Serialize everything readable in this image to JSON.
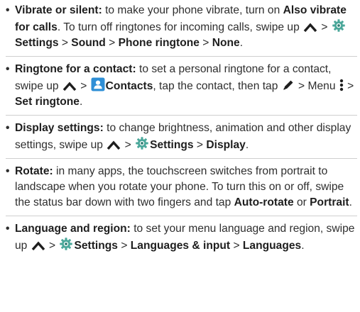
{
  "items": [
    {
      "title": "Vibrate or silent:",
      "t1": " to make your phone vibrate, turn on ",
      "b1": "Also vibrate for calls",
      "t2": ". To turn off ringtones for incoming calls, swipe up ",
      "t3": " > ",
      "b2": "Settings",
      "t4": " > ",
      "b3": "Sound",
      "t5": " > ",
      "b4": "Phone ringtone",
      "t6": " > ",
      "b5": "None",
      "t7": "."
    },
    {
      "title": "Ringtone for a contact:",
      "t1": " to set a personal ringtone for a contact, swipe up ",
      "t2": " > ",
      "b1": "Contacts",
      "t3": ", tap the contact, then tap ",
      "t4": " > Menu ",
      "t5": " > ",
      "b2": "Set ringtone",
      "t6": "."
    },
    {
      "title": "Display settings:",
      "t1": " to change brightness, animation and other display settings, swipe up ",
      "t2": " > ",
      "b1": "Settings",
      "t3": " > ",
      "b2": "Display",
      "t4": "."
    },
    {
      "title": "Rotate:",
      "t1": " in many apps, the touchscreen switches from portrait to landscape when you rotate your phone. To turn this on or off, swipe the status bar down with two fingers and tap ",
      "b1": "Auto-rotate",
      "t2": " or ",
      "b2": "Portrait",
      "t3": "."
    },
    {
      "title": "Language and region:",
      "t1": " to set your menu language and region, swipe up ",
      "t2": " > ",
      "b1": "Settings",
      "t3": " > ",
      "b2": "Languages & input",
      "t4": " > ",
      "b3": "Languages",
      "t5": "."
    }
  ],
  "bullet": "•",
  "icons": {
    "swipe_up": "chevron-up-icon",
    "settings": "gear-icon",
    "contacts": "contacts-icon",
    "edit": "pencil-icon",
    "menu": "vertical-dots-icon"
  },
  "colors": {
    "text": "#2e2e2e",
    "gear": "#4aa79a",
    "contacts": "#2f8fd6"
  }
}
